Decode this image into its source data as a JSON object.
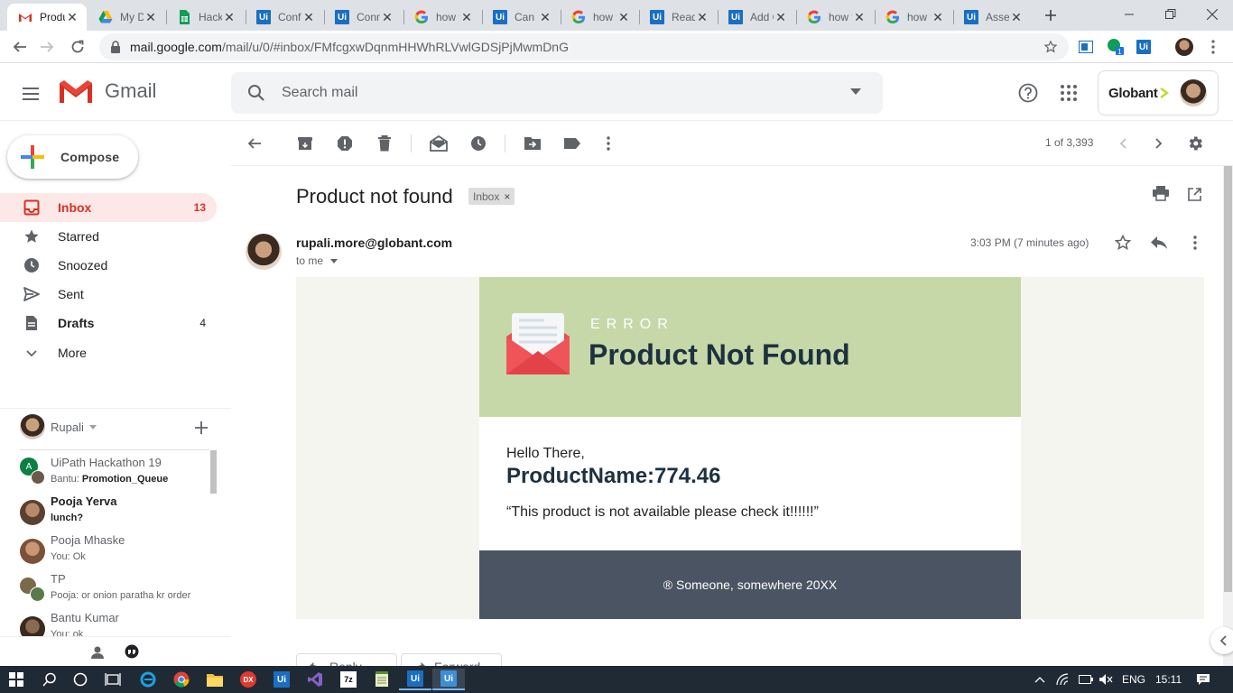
{
  "browser": {
    "tabs": [
      {
        "title": "Product not found - rupali.more@globant.com - Globant Mail",
        "favicon": "gmail-icon",
        "active": true
      },
      {
        "title": "My Drive - Google Drive",
        "favicon": "drive-icon"
      },
      {
        "title": "Hackathon - Google Sheets",
        "favicon": "sheets-icon"
      },
      {
        "title": "Configure Robot - UiPath",
        "favicon": "uipath-icon"
      },
      {
        "title": "Connect - UiPath",
        "favicon": "uipath-icon"
      },
      {
        "title": "how to - Google Search",
        "favicon": "google-icon"
      },
      {
        "title": "Can I - UiPath Forum",
        "favicon": "uipath-icon"
      },
      {
        "title": "how to - Google Search",
        "favicon": "google-icon"
      },
      {
        "title": "Read Range - UiPath",
        "favicon": "uipath-icon"
      },
      {
        "title": "Add Queue Item - UiPath",
        "favicon": "uipath-icon"
      },
      {
        "title": "how to - Google Search",
        "favicon": "google-icon"
      },
      {
        "title": "how to - Google Search",
        "favicon": "google-icon"
      },
      {
        "title": "Assets - UiPath",
        "favicon": "uipath-icon"
      }
    ],
    "url_host": "mail.google.com",
    "url_path": "/mail/u/0/#inbox/FMfcgxwDqnmHHWhRLVwlGDSjPjMwmDnG",
    "profile_badge": "1"
  },
  "gmail": {
    "product_name": "Gmail",
    "search_placeholder": "Search mail",
    "org_logo": "Globant",
    "compose_label": "Compose",
    "nav": [
      {
        "label": "Inbox",
        "count": "13",
        "icon": "inbox-icon"
      },
      {
        "label": "Starred",
        "count": "",
        "icon": "star-icon"
      },
      {
        "label": "Snoozed",
        "count": "",
        "icon": "clock-icon"
      },
      {
        "label": "Sent",
        "count": "",
        "icon": "send-icon"
      },
      {
        "label": "Drafts",
        "count": "4",
        "icon": "draft-icon"
      },
      {
        "label": "More",
        "count": "",
        "icon": "chevron-down-icon"
      }
    ],
    "hangouts": {
      "user": "Rupali",
      "chats": [
        {
          "name": "UiPath Hackathon 19",
          "snippet_prefix": "Bantu: ",
          "snippet": "Promotion_Queue",
          "avatar_letter": "A"
        },
        {
          "name": "Pooja Yerva",
          "snippet_prefix": "",
          "snippet": "lunch?",
          "unread": true
        },
        {
          "name": "Pooja Mhaske",
          "snippet_prefix": "You: ",
          "snippet": "Ok"
        },
        {
          "name": "TP",
          "snippet_prefix": "Pooja: ",
          "snippet": "or onion paratha kr order"
        },
        {
          "name": "Bantu Kumar",
          "snippet_prefix": "You: ",
          "snippet": "ok"
        }
      ]
    },
    "pagination": "1 of 3,393",
    "message": {
      "subject": "Product not found",
      "label_chip": "Inbox",
      "sender": "rupali.more@globant.com",
      "recipient": "to me",
      "time": "3:03 PM (7 minutes ago)",
      "body": {
        "eyebrow": "ERROR",
        "title": "Product Not Found",
        "greeting": "Hello There,",
        "product_line": "ProductName:774.46",
        "message": "“This product is not available please check it!!!!!!”",
        "footer": "® Someone, somewhere 20XX"
      },
      "reply_label": "Reply",
      "forward_label": "Forward"
    }
  },
  "taskbar": {
    "language": "ENG",
    "clock": "15:11"
  },
  "colors": {
    "gmail_red": "#d93025",
    "email_header_bg": "#c6d8a8",
    "email_title": "#1d3140",
    "email_footer_bg": "#4a5462",
    "taskbar_bg": "#202a35"
  }
}
